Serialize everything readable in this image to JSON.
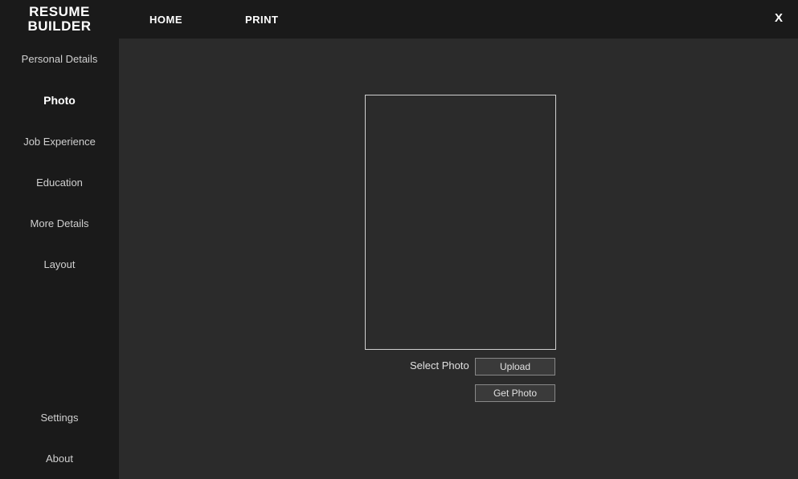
{
  "header": {
    "logo_line1": "RESUME",
    "logo_line2": "BUILDER",
    "nav": {
      "home": "HOME",
      "print": "PRINT"
    },
    "close": "X"
  },
  "sidebar": {
    "items": [
      {
        "label": "Personal Details",
        "active": false
      },
      {
        "label": "Photo",
        "active": true
      },
      {
        "label": "Job Experience",
        "active": false
      },
      {
        "label": "Education",
        "active": false
      },
      {
        "label": "More Details",
        "active": false
      },
      {
        "label": "Layout",
        "active": false
      }
    ],
    "bottom": [
      {
        "label": "Settings"
      },
      {
        "label": "About"
      }
    ]
  },
  "main": {
    "select_label": "Select Photo",
    "upload_btn": "Upload",
    "getphoto_btn": "Get Photo"
  }
}
